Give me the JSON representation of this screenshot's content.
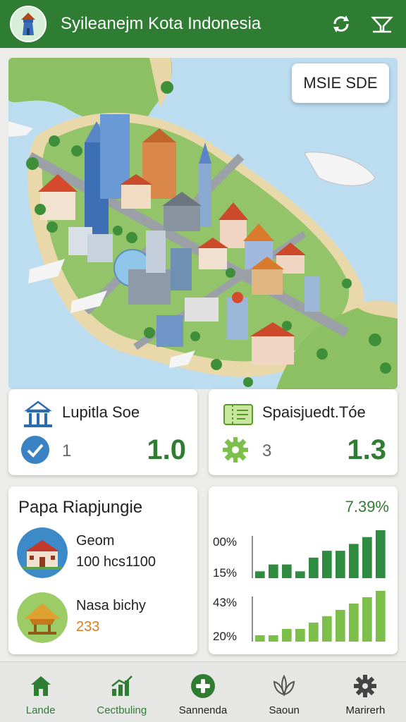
{
  "app": {
    "title": "Syileanejm Kota Indonesia"
  },
  "header": {
    "refresh_icon": "refresh-icon",
    "filter_icon": "filter-icon"
  },
  "map": {
    "badge": "MSIE SDE"
  },
  "stats": [
    {
      "title": "Lupitla Soe",
      "count": "1",
      "value": "1.0",
      "icon": "landmark-icon",
      "sub_icon": "checkmark-icon"
    },
    {
      "title": "Spaisjuedt.Tóe",
      "count": "3",
      "value": "1.3",
      "icon": "ticket-icon",
      "sub_icon": "gear-icon"
    }
  ],
  "list": {
    "title": "Papa Riapjungie",
    "items": [
      {
        "name": "Geom",
        "meta": "100 hcs1100",
        "thumb": "museum-thumb"
      },
      {
        "name": "Nasa bichy",
        "meta": "233",
        "thumb": "pavilion-thumb"
      }
    ]
  },
  "chart_data": [
    {
      "type": "bar",
      "title": "7.39%",
      "yticks": [
        "00%",
        "15%"
      ],
      "values": [
        1,
        2,
        2,
        1,
        3,
        4,
        4,
        5,
        6,
        7
      ],
      "color": "#2e8b3f"
    },
    {
      "type": "bar",
      "yticks": [
        "43%",
        "20%"
      ],
      "values": [
        1,
        1,
        2,
        2,
        3,
        4,
        5,
        6,
        7,
        8
      ],
      "color": "#7cbf4a"
    }
  ],
  "nav": [
    {
      "label": "Lande",
      "icon": "home-icon",
      "active": true
    },
    {
      "label": "Cectbuling",
      "icon": "chart-icon",
      "active": true
    },
    {
      "label": "Sannenda",
      "icon": "plus-circle-icon",
      "active": false
    },
    {
      "label": "Saoun",
      "icon": "lotus-icon",
      "active": false
    },
    {
      "label": "Marirerh",
      "icon": "gear-icon",
      "active": false
    }
  ],
  "colors": {
    "primary": "#2e7d32",
    "accent": "#43a047",
    "light_green": "#7cbf4a",
    "orange": "#e07b1f"
  }
}
